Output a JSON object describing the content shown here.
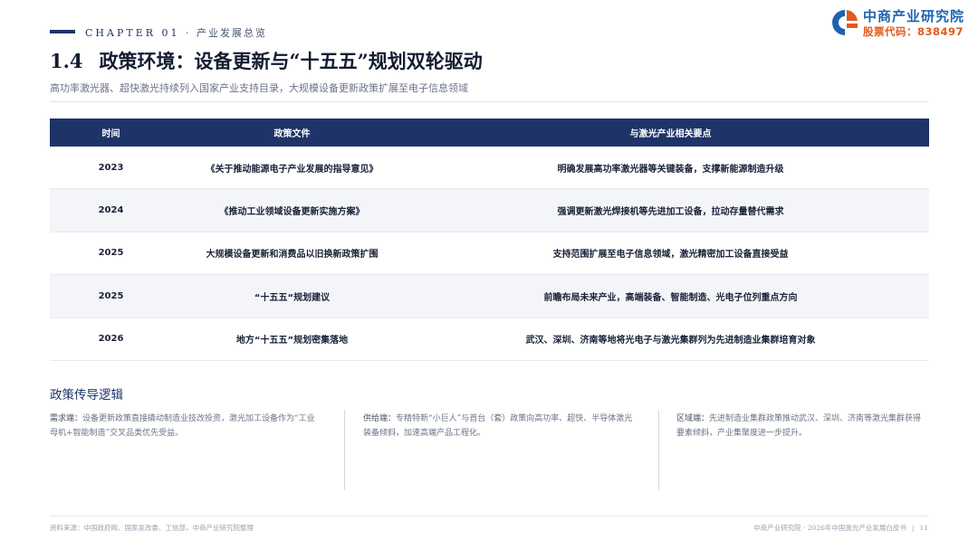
{
  "header": {
    "chapter": "CHAPTER 01",
    "chapter_sep": "·",
    "chapter_sub": "产业发展总览",
    "logo_name": "中商产业研究院",
    "logo_code": "股票代码：838497"
  },
  "title": {
    "number": "1.4",
    "text": "政策环境：设备更新与“十五五”规划双轮驱动"
  },
  "subtitle": "高功率激光器、超快激光持续列入国家产业支持目录，大规模设备更新政策扩展至电子信息领域",
  "table": {
    "headers": [
      "时间",
      "政策文件",
      "与激光产业相关要点"
    ],
    "rows": [
      {
        "year": "2023",
        "doc": "《关于推动能源电子产业发展的指导意见》",
        "point": "明确发展高功率激光器等关键装备，支撑新能源制造升级"
      },
      {
        "year": "2024",
        "doc": "《推动工业领域设备更新实施方案》",
        "point": "强调更新激光焊接机等先进加工设备，拉动存量替代需求"
      },
      {
        "year": "2025",
        "doc": "大规模设备更新和消费品以旧换新政策扩围",
        "point": "支持范围扩展至电子信息领域，激光精密加工设备直接受益"
      },
      {
        "year": "2025",
        "doc": "“十五五“规划建议",
        "point": "前瞻布局未来产业，高端装备、智能制造、光电子位列重点方向"
      },
      {
        "year": "2026",
        "doc": "地方“十五五”规划密集落地",
        "point": "武汉、深圳、济南等地将光电子与激光集群列为先进制造业集群培育对象"
      }
    ]
  },
  "logic": {
    "title": "政策传导逻辑",
    "columns": [
      {
        "label": "需求端：",
        "text": "设备更新政策直接撬动制造业技改投资，激光加工设备作为“工业母机+智能制造”交叉品类优先受益。"
      },
      {
        "label": "供给端：",
        "text": "专精特新“小巨人”与首台（套）政策向高功率、超快、半导体激光装备倾斜，加速高端产品工程化。"
      },
      {
        "label": "区域端：",
        "text": "先进制造业集群政策推动武汉、深圳、济南等激光集群获得要素倾斜，产业集聚度进一步提升。"
      }
    ]
  },
  "footer": {
    "source": "资料来源：中国政府网、国家发改委、工信部，中商产业研究院整理",
    "right": "中商产业研究院 · 2026年中国激光产业发展白皮书",
    "sep": "|",
    "page": "11"
  },
  "colors": {
    "navy": "#1e3468",
    "logo_blue": "#1e62b0",
    "logo_orange": "#e05a1c"
  },
  "icons": {
    "logo": "zhongshang-logo-icon"
  }
}
